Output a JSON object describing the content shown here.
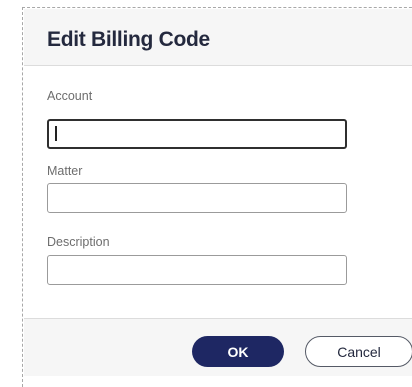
{
  "dialog": {
    "title": "Edit Billing Code"
  },
  "fields": {
    "account": {
      "label": "Account",
      "value": "",
      "placeholder": ""
    },
    "matter": {
      "label": "Matter",
      "value": "",
      "placeholder": ""
    },
    "description": {
      "label": "Description",
      "value": "",
      "placeholder": ""
    }
  },
  "footer": {
    "ok_label": "OK",
    "cancel_label": "Cancel"
  },
  "colors": {
    "primary_button": "#1e2763",
    "title_text": "#24293e",
    "header_background": "#f6f6f6"
  }
}
